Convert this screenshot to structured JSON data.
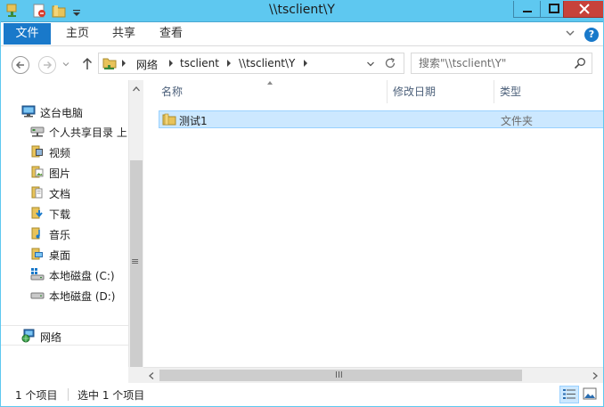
{
  "window": {
    "title": "\\\\tsclient\\Y",
    "frame_color": "#5ec8f0",
    "qat_icons": [
      "properties-icon",
      "new-folder-icon",
      "customize-quick-access-icon"
    ],
    "controls": [
      "minimize-icon",
      "maximize-icon",
      "close-icon"
    ]
  },
  "ribbon": {
    "tabs": [
      "文件",
      "主页",
      "共享",
      "查看"
    ],
    "active_tab_color": "#1979ca",
    "help_glyph": "?"
  },
  "address": {
    "crumbs": [
      "网络",
      "tsclient",
      "\\\\tsclient\\Y"
    ],
    "search_placeholder": "搜索\"\\\\tsclient\\Y\""
  },
  "navpane": {
    "items": [
      {
        "label": "这台电脑",
        "icon": "this-pc-icon"
      },
      {
        "label": "个人共享目录 上",
        "icon": "network-drive-icon"
      },
      {
        "label": "视频",
        "icon": "videos-folder-icon"
      },
      {
        "label": "图片",
        "icon": "pictures-folder-icon"
      },
      {
        "label": "文档",
        "icon": "documents-folder-icon"
      },
      {
        "label": "下载",
        "icon": "downloads-folder-icon"
      },
      {
        "label": "音乐",
        "icon": "music-folder-icon"
      },
      {
        "label": "桌面",
        "icon": "desktop-folder-icon"
      },
      {
        "label": "本地磁盘 (C:)",
        "icon": "system-drive-icon"
      },
      {
        "label": "本地磁盘 (D:)",
        "icon": "local-drive-icon"
      },
      {
        "label": "网络",
        "icon": "network-icon"
      }
    ],
    "scroll_grip": "≡"
  },
  "filelist": {
    "columns": [
      "名称",
      "修改日期",
      "类型"
    ],
    "rows": [
      {
        "name": "测试1",
        "modified": "",
        "type": "文件夹",
        "selected": true,
        "icon": "folder-icon"
      }
    ],
    "selection_color": "#cce8ff",
    "scroll_grip": "III"
  },
  "status": {
    "item_count": "1 个项目",
    "selected_count": "选中 1 个项目",
    "view_buttons": [
      "details-view-icon",
      "large-icons-view-icon"
    ]
  }
}
